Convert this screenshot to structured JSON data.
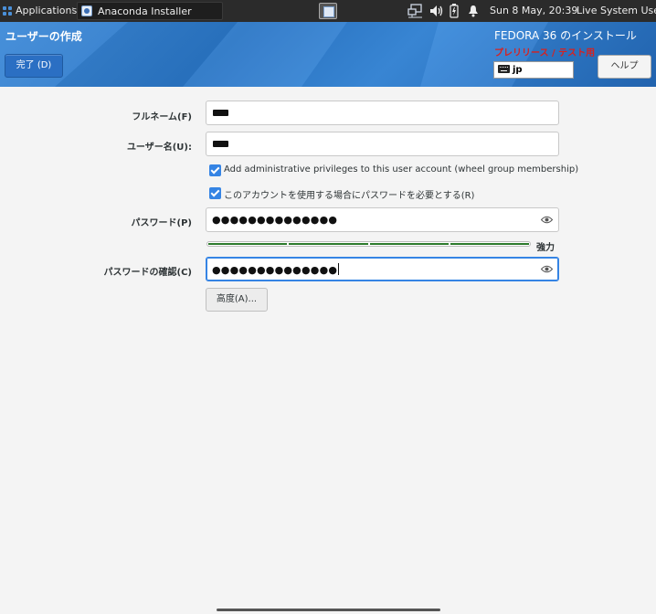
{
  "topbar": {
    "applications_label": "Applications",
    "window_label": "Anaconda Installer",
    "clock": "Sun  8 May, 20:39",
    "user": "Live System User"
  },
  "header": {
    "spoke_title": "ユーザーの作成",
    "done_label": "完了 (D)",
    "product": "FEDORA 36 のインストール",
    "prerelease": "プレリリース / テスト用",
    "keyboard_layout": "jp",
    "help_label": "ヘルプ"
  },
  "form": {
    "fullname_label": "フルネーム(F)",
    "username_label": "ユーザー名(U):",
    "admin_checkbox_label": "Add administrative privileges to this user account (wheel group membership)",
    "admin_checked": true,
    "require_password_label": "このアカウントを使用する場合にパスワードを必要とする(R)",
    "require_password_checked": true,
    "password_label": "パスワード(P)",
    "password_value": "●●●●●●●●●●●●●●",
    "strength_label": "強力",
    "strength_level": 1.0,
    "confirm_label": "パスワードの確認(C)",
    "confirm_value": "●●●●●●●●●●●●●●",
    "advanced_label": "高度(A)..."
  },
  "colors": {
    "topbar": "#2b2b2b",
    "header": "#2a76c6",
    "accent": "#3584e4",
    "prerelease": "#d8211f",
    "strength": "#2c7a2c"
  }
}
